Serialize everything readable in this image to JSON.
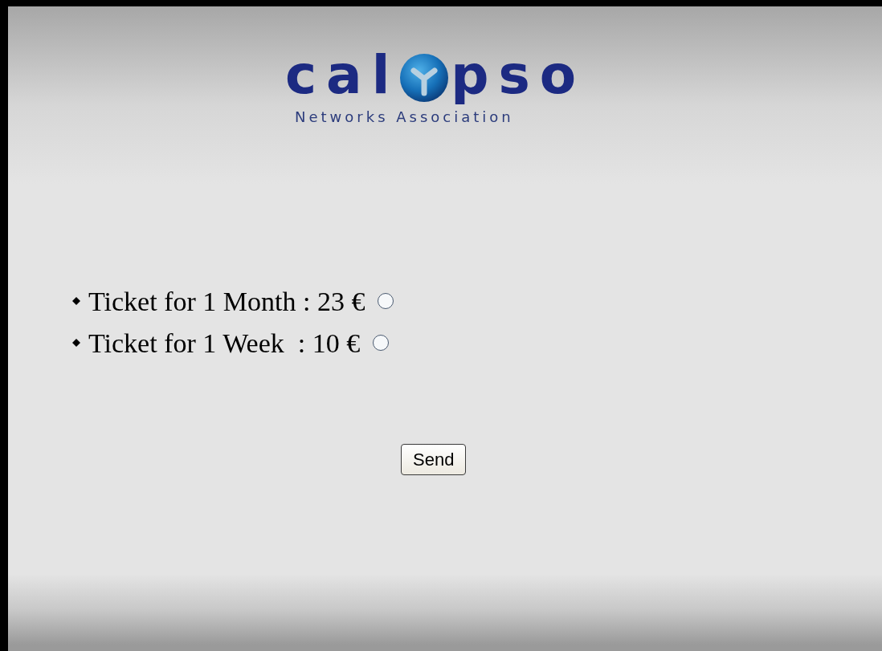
{
  "logo": {
    "left": "cal",
    "right": "pso",
    "subtitle": "Networks Association"
  },
  "options": [
    {
      "label": "Ticket for 1 Month : 23 €",
      "selected": false
    },
    {
      "label": "Ticket for 1 Week  : 10 €",
      "selected": false
    }
  ],
  "submit": {
    "label": "Send"
  }
}
